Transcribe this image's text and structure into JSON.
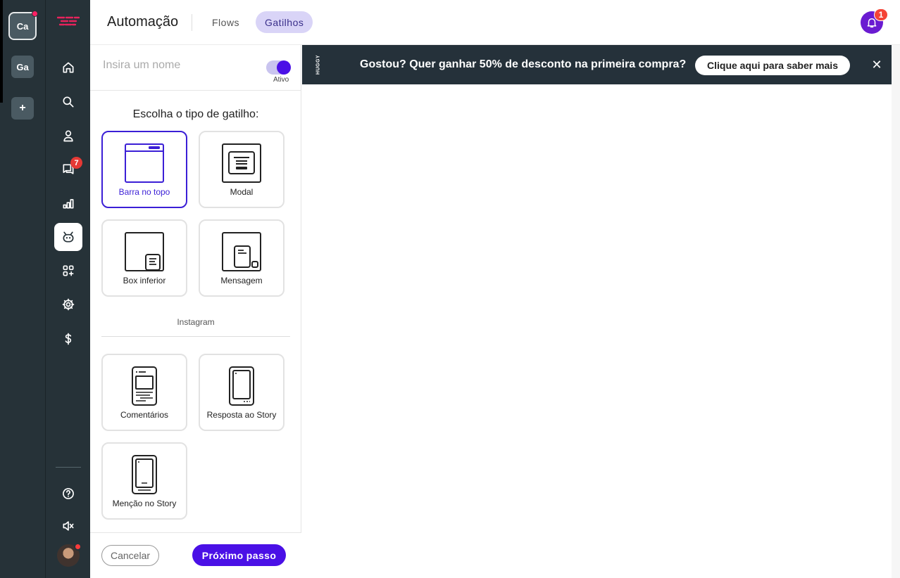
{
  "workspaces": [
    {
      "initials": "Ca",
      "active": true
    },
    {
      "initials": "Ga",
      "active": false
    }
  ],
  "workspace_add": "+",
  "nav": {
    "chat_badge": "7",
    "icons": [
      "home-icon",
      "search-icon",
      "contacts-icon",
      "chat-icon",
      "reports-icon",
      "automation-bot-icon",
      "integrations-icon",
      "settings-icon",
      "billing-icon",
      "help-icon",
      "sound-muted-icon"
    ]
  },
  "header": {
    "title": "Automação",
    "tabs": [
      {
        "label": "Flows",
        "active": false
      },
      {
        "label": "Gatilhos",
        "active": true
      }
    ],
    "notification_count": "1"
  },
  "panel": {
    "name_placeholder": "Insira um nome",
    "toggle_label": "Ativo",
    "heading": "Escolha o tipo de gatilho:",
    "triggers": [
      {
        "label": "Barra no topo",
        "icon": "top-bar-icon",
        "selected": true
      },
      {
        "label": "Modal",
        "icon": "modal-icon",
        "selected": false
      },
      {
        "label": "Box inferior",
        "icon": "bottom-box-icon",
        "selected": false
      },
      {
        "label": "Mensagem",
        "icon": "message-icon",
        "selected": false
      }
    ],
    "instagram_label": "Instagram",
    "instagram_triggers": [
      {
        "label": "Comentários",
        "icon": "comments-phone-icon"
      },
      {
        "label": "Resposta ao Story",
        "icon": "story-reply-phone-icon"
      },
      {
        "label": "Menção no Story",
        "icon": "story-mention-phone-icon"
      }
    ],
    "cancel_label": "Cancelar",
    "next_label": "Próximo passo"
  },
  "promo": {
    "brand": "HUGGY",
    "text": "Gostou? Quer ganhar 50% de desconto na primeira compra?",
    "cta": "Clique aqui para saber mais",
    "close": "✕"
  },
  "colors": {
    "sidebar": "#263238",
    "accent": "#4a10e6",
    "promo_bg": "#25313a",
    "notification": "#6a1bd1"
  }
}
